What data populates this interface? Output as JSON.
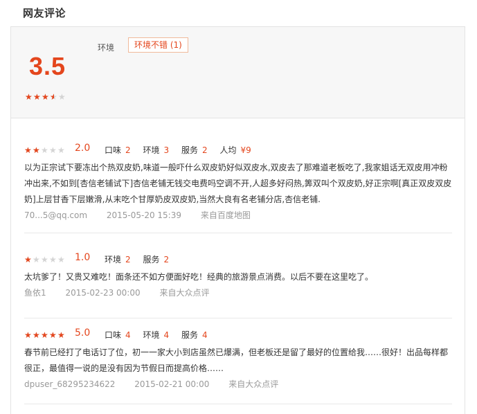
{
  "section_title": "网友评论",
  "summary": {
    "score": "3.5",
    "rating": 3.5,
    "tag_label": "环境",
    "tag_chip": "环境不错 (1)"
  },
  "colors": {
    "accent": "#e4461d",
    "star_empty": "#d4d4d4"
  },
  "reviews": [
    {
      "rating": 2,
      "score": "2.0",
      "items": [
        {
          "label": "口味",
          "value": "2"
        },
        {
          "label": "环境",
          "value": "3"
        },
        {
          "label": "服务",
          "value": "2"
        },
        {
          "label": "人均",
          "value": "¥9"
        }
      ],
      "text": "以为正宗试下要冻出个热双皮奶,味道一般吓什么双皮奶好似双皮水,双皮去了那难道老板吃了,我家姐话无双皮用冲粉冲出来,不如到[杏信老铺试下]杏信老铺无钱交电费吗空调不开,人超多好闷热,筭双叫个双皮奶,好正宗啊[真正双皮双皮奶]上层甘香下层嫩滑,从末吃个甘厚奶皮双皮奶,当然大良有名老铺分店,杏信老铺.",
      "user": "70...5@qq.com",
      "date": "2015-05-20 15:39",
      "source": "来自百度地图"
    },
    {
      "rating": 1,
      "score": "1.0",
      "items": [
        {
          "label": "环境",
          "value": "2"
        },
        {
          "label": "服务",
          "value": "2"
        }
      ],
      "text": "太坑爹了！又贵又难吃！面条还不如方便面好吃！经典的旅游景点消费。以后不要在这里吃了。",
      "user": "鱼依1",
      "date": "2015-02-23 00:00",
      "source": "来自大众点评"
    },
    {
      "rating": 5,
      "score": "5.0",
      "items": [
        {
          "label": "口味",
          "value": "4"
        },
        {
          "label": "环境",
          "value": "4"
        },
        {
          "label": "服务",
          "value": "4"
        }
      ],
      "text": "春节前已经打了电话订了位，初一一家大小到店虽然已爆满，但老板还是留了最好的位置给我……很好！出品每样都很正，最值得一说的是没有因为节假日而提高价格……",
      "user": "dpuser_68295234622",
      "date": "2015-02-21 00:00",
      "source": "来自大众点评"
    }
  ]
}
